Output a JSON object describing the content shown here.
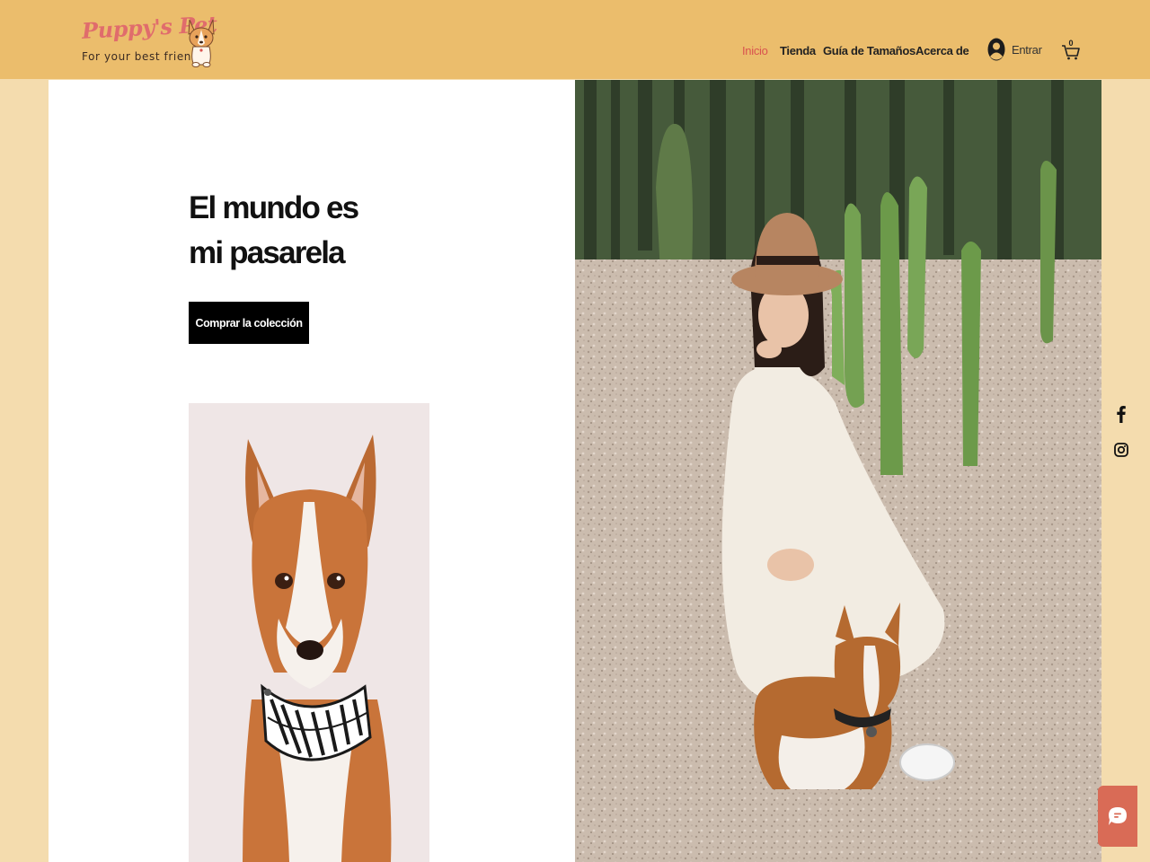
{
  "brand": {
    "name": "Puppy's Pet",
    "tagline": "For your best friend"
  },
  "nav": {
    "items": [
      {
        "label": "Inicio",
        "active": true
      },
      {
        "label": "Tienda",
        "active": false
      },
      {
        "label": "Guía de Tamaños",
        "active": false
      },
      {
        "label": "Acerca de",
        "active": false
      }
    ],
    "login_label": "Entrar",
    "cart_count": "0"
  },
  "hero": {
    "headline_line1": "El mundo es",
    "headline_line2": "mi pasarela",
    "cta_label": "Comprar la colección"
  },
  "social": {
    "icons": [
      "facebook-icon",
      "instagram-icon"
    ]
  },
  "chat": {
    "icon": "chat-icon"
  },
  "colors": {
    "header_bg": "#ebbd6c",
    "page_bg": "#f4dcae",
    "accent": "#d9534f",
    "button_bg": "#000000",
    "chat_bg": "#d96b56"
  }
}
